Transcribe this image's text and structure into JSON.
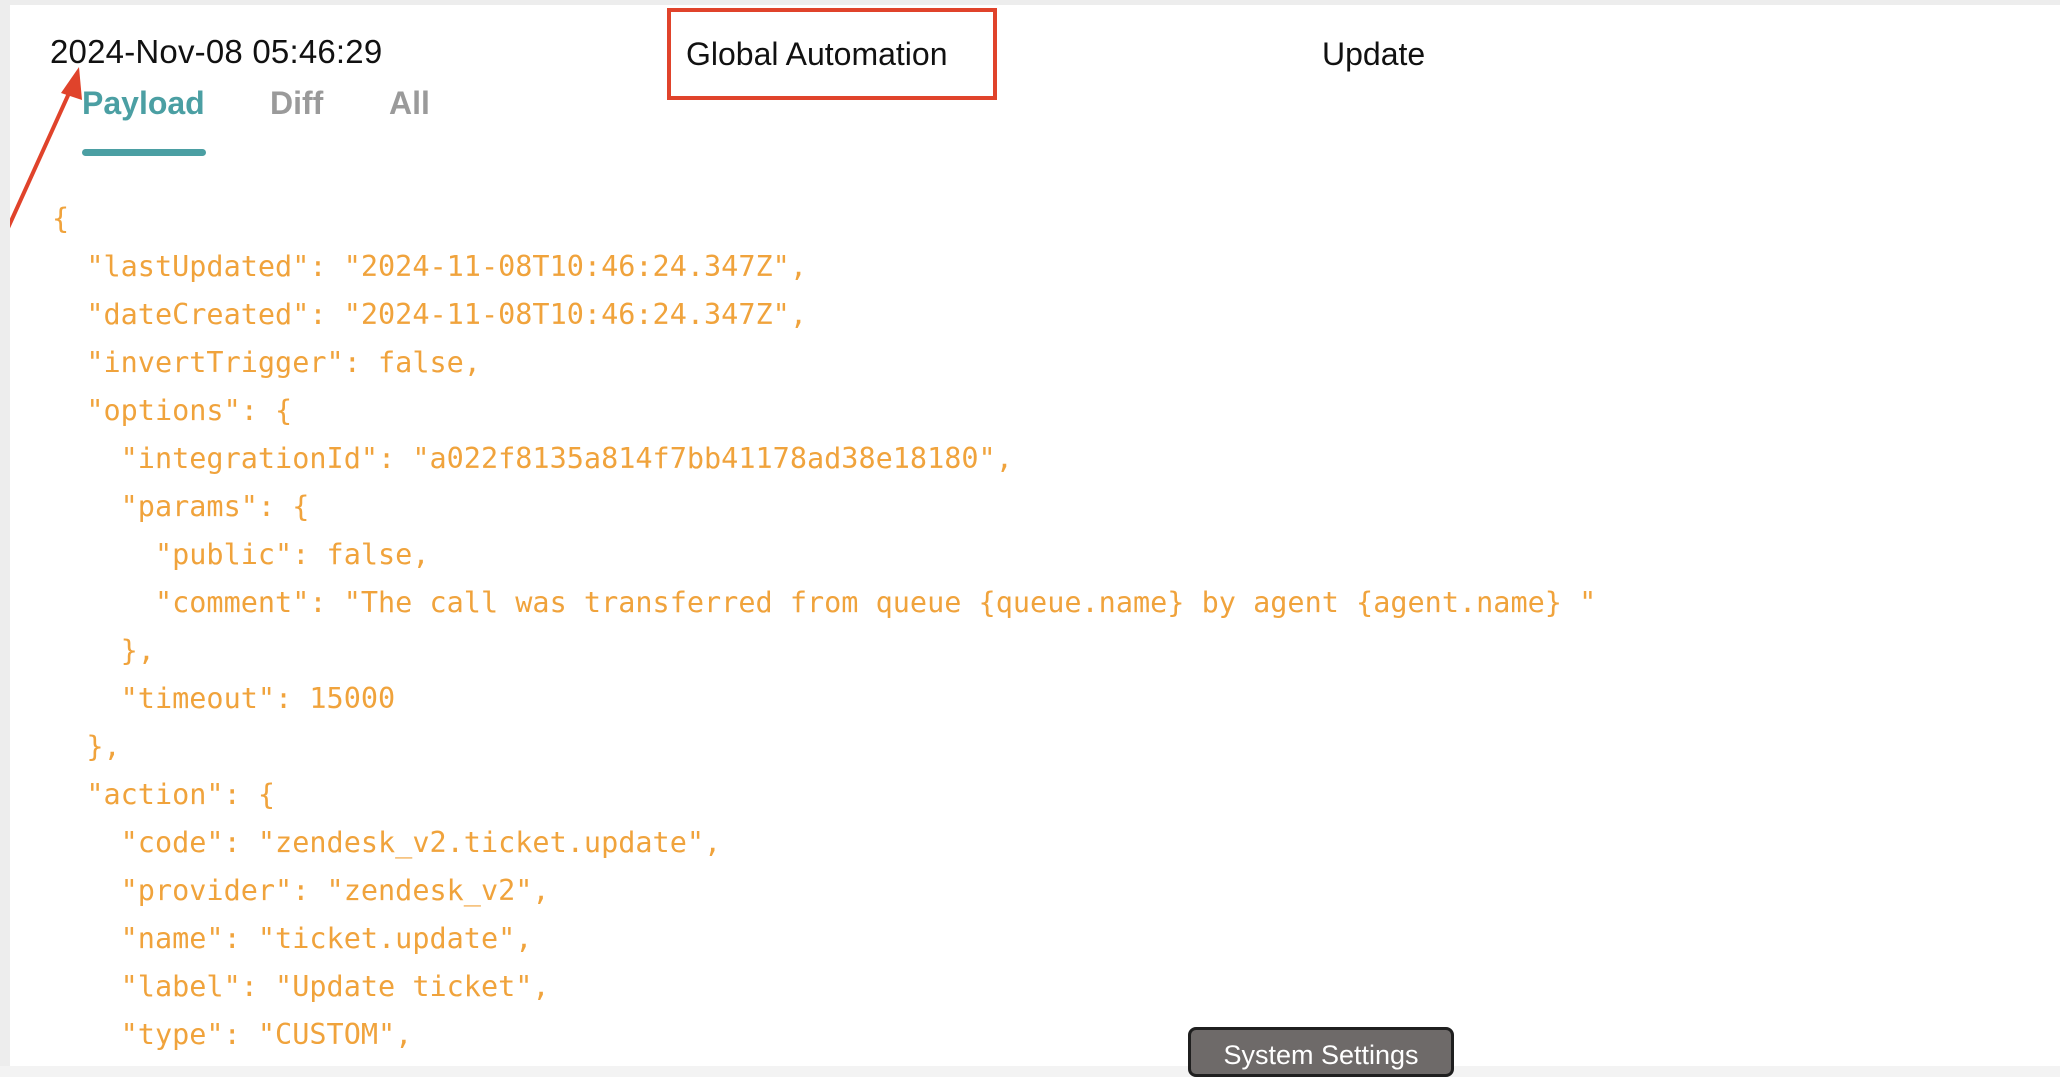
{
  "header": {
    "timestamp": "2024-Nov-08 05:46:29",
    "title": "Global Automation",
    "action": "Update"
  },
  "tabs": [
    {
      "label": "Payload",
      "active": true
    },
    {
      "label": "Diff",
      "active": false
    },
    {
      "label": "All",
      "active": false
    }
  ],
  "payload_lines": [
    "{",
    "  \"lastUpdated\": \"2024-11-08T10:46:24.347Z\",",
    "  \"dateCreated\": \"2024-11-08T10:46:24.347Z\",",
    "  \"invertTrigger\": false,",
    "  \"options\": {",
    "    \"integrationId\": \"a022f8135a814f7bb41178ad38e18180\",",
    "    \"params\": {",
    "      \"public\": false,",
    "      \"comment\": \"The call was transferred from queue {queue.name} by agent {agent.name} \"",
    "    },",
    "    \"timeout\": 15000",
    "  },",
    "  \"action\": {",
    "    \"code\": \"zendesk_v2.ticket.update\",",
    "    \"provider\": \"zendesk_v2\",",
    "    \"name\": \"ticket.update\",",
    "    \"label\": \"Update ticket\",",
    "    \"type\": \"CUSTOM\","
  ],
  "tooltip": "System Settings",
  "colors": {
    "accent": "#4b9fa3",
    "code": "#f0a33c",
    "annotation": "#e0432b",
    "inactive_tab": "#9a9a9a"
  },
  "icons": {
    "annotation_arrow": "arrow-icon"
  }
}
